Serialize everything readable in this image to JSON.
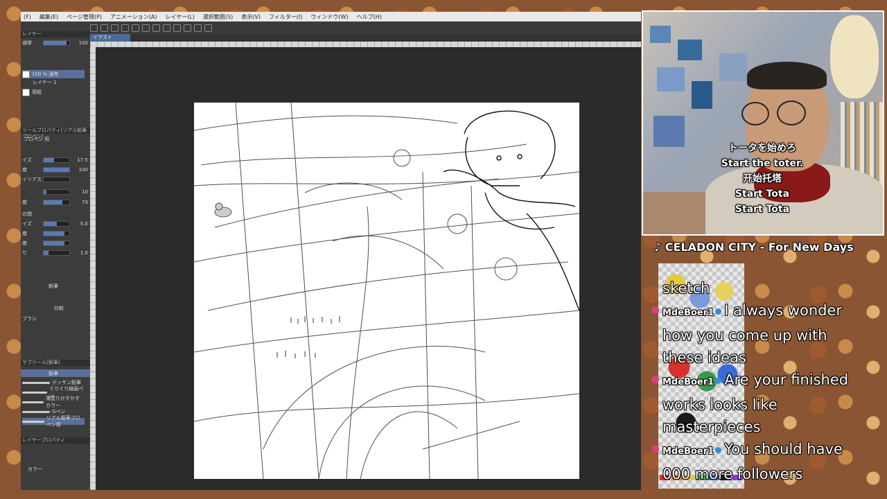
{
  "menu": [
    "(F)",
    "編集(E)",
    "ページ管理(P)",
    "アニメーション(A)",
    "レイヤー(L)",
    "選択範囲(S)",
    "表示(V)",
    "フィルター(I)",
    "ウィンドウ(W)",
    "ヘルプ(H)"
  ],
  "document_tab": "イラスト",
  "left_panel": {
    "layer_header": "レイヤー",
    "blend_mode": "通常",
    "opacity": "100",
    "layers": [
      {
        "name": "100 % 通常",
        "sub": "レイヤー 1"
      },
      {
        "name": "用紙"
      }
    ],
    "tool_property_header": "ツールプロパティ[リアル鉛筆プロペン]",
    "tool_name": "プロペン 用",
    "properties": [
      {
        "label": "イズ",
        "value": "17.5"
      },
      {
        "label": "度",
        "value": "100"
      },
      {
        "label": "イリアス",
        "value": ""
      },
      {
        "label": "",
        "value": "10"
      },
      {
        "label": "度",
        "value": "73"
      },
      {
        "label": "の間",
        "value": ""
      },
      {
        "label": "イズ",
        "value": "5.0"
      },
      {
        "label": "度",
        "value": ""
      },
      {
        "label": "度",
        "value": ""
      },
      {
        "label": "り",
        "value": "1.0"
      }
    ],
    "pen_mode": "鉛筆",
    "apply_method": "比較",
    "brush_header": "ブラシ",
    "subtool_header": "サブツール[鉛筆]",
    "subtool_group": "鉛筆",
    "brushes": [
      "デッサン鉛筆",
      "ぐりぐり線画ペン",
      "薄塗りかすかす カラー",
      "Gペン",
      "リアル鉛筆プロペン用"
    ],
    "layer_property": "レイヤープロパティ",
    "color_label": "カラー"
  },
  "webcam": {
    "captions": [
      "トータを始めろ",
      "Start the toter.",
      "开始托塔",
      "Start Tota",
      "Start Tota"
    ]
  },
  "now_playing": "♪ CELADON CITY - For New Days",
  "chat": [
    {
      "user": "",
      "text": "sketch"
    },
    {
      "user": "MdeBoer1",
      "text": "I always wonder how you come up with these ideas"
    },
    {
      "user": "MdeBoer1",
      "text": "Are your finished works looks like masterpieces"
    },
    {
      "user": "MdeBoer1",
      "text": "You should have 000 more followers"
    }
  ],
  "colors": {
    "accent": "#5a7ab0",
    "chat_text": "#ffffff",
    "mod_badge": "#d8407a",
    "swatches": [
      "#d8302a",
      "#e87a2a",
      "#e8c840",
      "#3a9a4a",
      "#3a6ad8",
      "#1a1a1a",
      "#8a3ad8"
    ]
  }
}
